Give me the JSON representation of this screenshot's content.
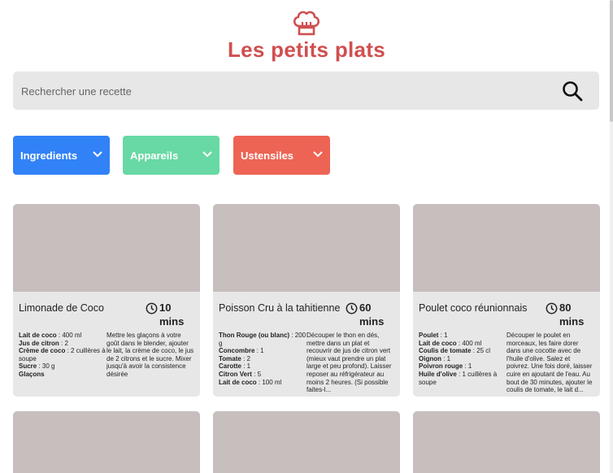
{
  "header": {
    "logo_icon": "chef-hat-icon",
    "title": "Les petits plats"
  },
  "search": {
    "placeholder": "Rechercher une recette",
    "value": "",
    "icon": "search-icon"
  },
  "filters": [
    {
      "label": "Ingredients",
      "color": "#3282F7"
    },
    {
      "label": "Appareils",
      "color": "#68D9A4"
    },
    {
      "label": "Ustensiles",
      "color": "#ED6454"
    }
  ],
  "colors": {
    "title": "#D04F4F",
    "card_bg": "#E7E7E7",
    "card_image": "#C7BEBE"
  },
  "recipes": [
    {
      "name": "Limonade de Coco",
      "time": "10 mins",
      "ingredients": [
        {
          "name": "Lait de coco",
          "qty": " : 400 ml"
        },
        {
          "name": "Jus de citron",
          "qty": " : 2"
        },
        {
          "name": "Crème de coco",
          "qty": " : 2 cuillères à soupe"
        },
        {
          "name": "Sucre",
          "qty": " : 30 g"
        },
        {
          "name": "Glaçons",
          "qty": ""
        }
      ],
      "description": "Mettre les glaçons à votre goût dans le blender, ajouter le lait, la crème de coco, le jus de 2 citrons et le sucre. Mixer jusqu'à avoir la consistence désirée"
    },
    {
      "name": "Poisson Cru à la tahitienne",
      "time": "60 mins",
      "ingredients": [
        {
          "name": "Thon Rouge (ou blanc)",
          "qty": " : 200 g"
        },
        {
          "name": "Concombre",
          "qty": " : 1"
        },
        {
          "name": "Tomate",
          "qty": " : 2"
        },
        {
          "name": "Carotte",
          "qty": " : 1"
        },
        {
          "name": "Citron Vert",
          "qty": " : 5"
        },
        {
          "name": "Lait de coco",
          "qty": " : 100 ml"
        }
      ],
      "description": "Découper le thon en dés, mettre dans un plat et recouvrir de jus de citron vert (mieux vaut prendre un plat large et peu profond). Laisser reposer au réfrigérateur au moins 2 heures. (Si possible faites-l..."
    },
    {
      "name": "Poulet coco réunionnais",
      "time": "80 mins",
      "ingredients": [
        {
          "name": "Poulet",
          "qty": " : 1"
        },
        {
          "name": "Lait de coco",
          "qty": " : 400 ml"
        },
        {
          "name": "Coulis de tomate",
          "qty": " : 25 cl"
        },
        {
          "name": "Oignon",
          "qty": " : 1"
        },
        {
          "name": "Poivron rouge",
          "qty": " : 1"
        },
        {
          "name": "Huile d'olive",
          "qty": " : 1 cuillères à soupe"
        }
      ],
      "description": "Découper le poulet en morceaux, les faire dorer dans une cocotte avec de l'huile d'olive. Salez et poivrez. Une fois doré, laisser cuire en ajoutant de l'eau. Au bout de 30 minutes, ajouter le coulis de tomate, le lait d..."
    }
  ]
}
